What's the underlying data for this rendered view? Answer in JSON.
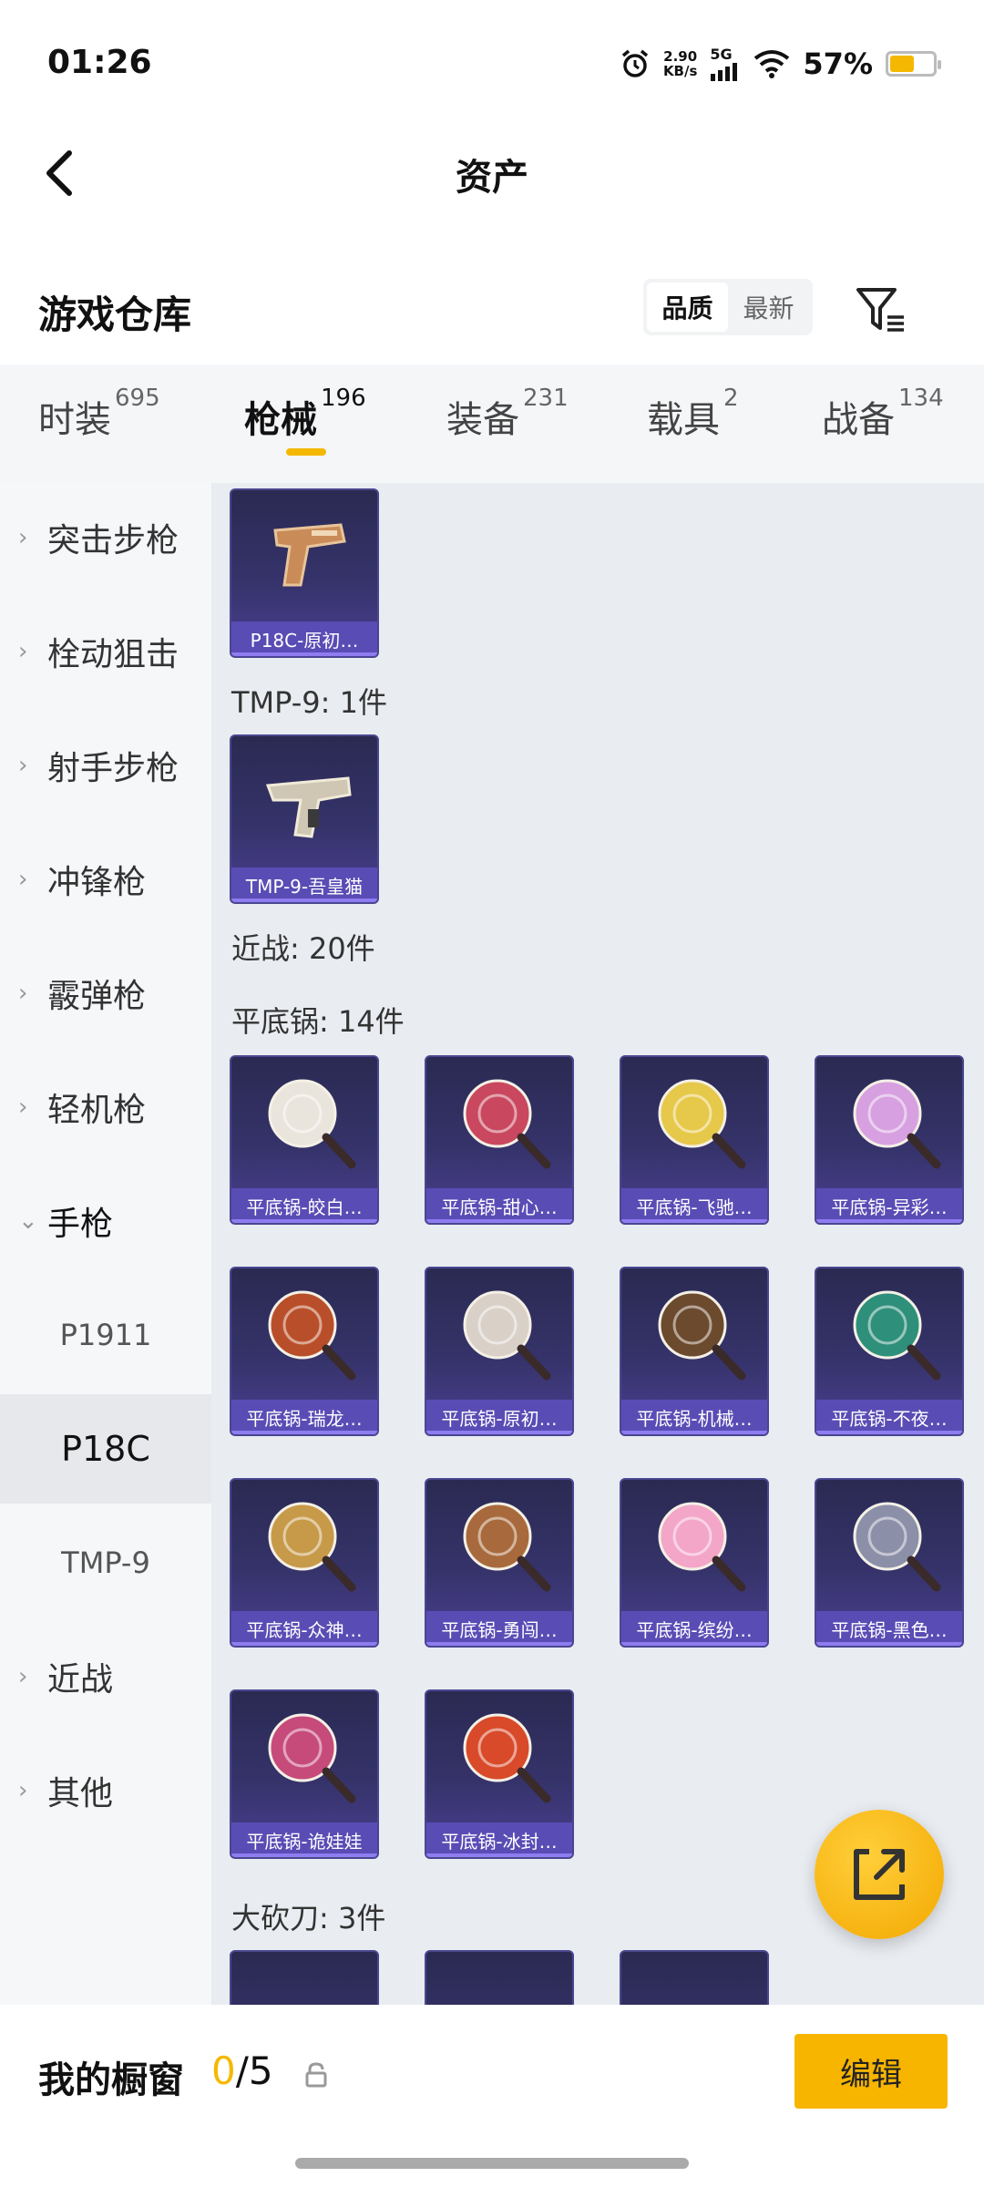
{
  "status_bar": {
    "time": "01:26",
    "net_speed_value": "2.90",
    "net_speed_unit": "KB/s",
    "network": "5G",
    "battery_pct": "57%",
    "battery_level": 0.57,
    "icons": [
      "alarm-icon",
      "signal-icon",
      "wifi-icon",
      "battery-icon"
    ]
  },
  "header": {
    "title": "资产"
  },
  "warehouse": {
    "title": "游戏仓库",
    "sort_options": [
      {
        "label": "品质",
        "active": true
      },
      {
        "label": "最新",
        "active": false
      }
    ]
  },
  "tabs": [
    {
      "label": "时装",
      "count": "695",
      "active": false
    },
    {
      "label": "枪械",
      "count": "196",
      "active": true
    },
    {
      "label": "装备",
      "count": "231",
      "active": false
    },
    {
      "label": "载具",
      "count": "2",
      "active": false
    },
    {
      "label": "战备",
      "count": "134",
      "active": false
    }
  ],
  "sidebar": {
    "items": [
      {
        "label": "突击步枪",
        "type": "category"
      },
      {
        "label": "栓动狙击",
        "type": "category"
      },
      {
        "label": "射手步枪",
        "type": "category"
      },
      {
        "label": "冲锋枪",
        "type": "category"
      },
      {
        "label": "霰弹枪",
        "type": "category"
      },
      {
        "label": "轻机枪",
        "type": "category"
      },
      {
        "label": "手枪",
        "type": "expanded"
      },
      {
        "label": "P1911",
        "type": "sub"
      },
      {
        "label": "P18C",
        "type": "selected"
      },
      {
        "label": "TMP-9",
        "type": "sub"
      },
      {
        "label": "近战",
        "type": "category"
      },
      {
        "label": "其他",
        "type": "category"
      }
    ]
  },
  "content": {
    "p18c_item": "P18C-原初…",
    "tmp9_label": "TMP-9: 1件",
    "tmp9_item": "TMP-9-吾皇猫",
    "melee_label": "近战: 20件",
    "pan_label": "平底锅: 14件",
    "pans": [
      "平底锅-皎白…",
      "平底锅-甜心…",
      "平底锅-飞驰…",
      "平底锅-异彩…",
      "平底锅-瑞龙…",
      "平底锅-原初…",
      "平底锅-机械…",
      "平底锅-不夜…",
      "平底锅-众神…",
      "平底锅-勇闯…",
      "平底锅-缤纷…",
      "平底锅-黑色…",
      "平底锅-诡娃娃",
      "平底锅-冰封…"
    ],
    "machete_label": "大砍刀: 3件"
  },
  "bottom": {
    "label": "我的橱窗",
    "current": "0",
    "separator": "/",
    "total": "5",
    "edit_label": "编辑"
  },
  "colors": {
    "accent": "#f5b800",
    "card_bg": "#35336a",
    "card_label": "#5a4cb5"
  }
}
